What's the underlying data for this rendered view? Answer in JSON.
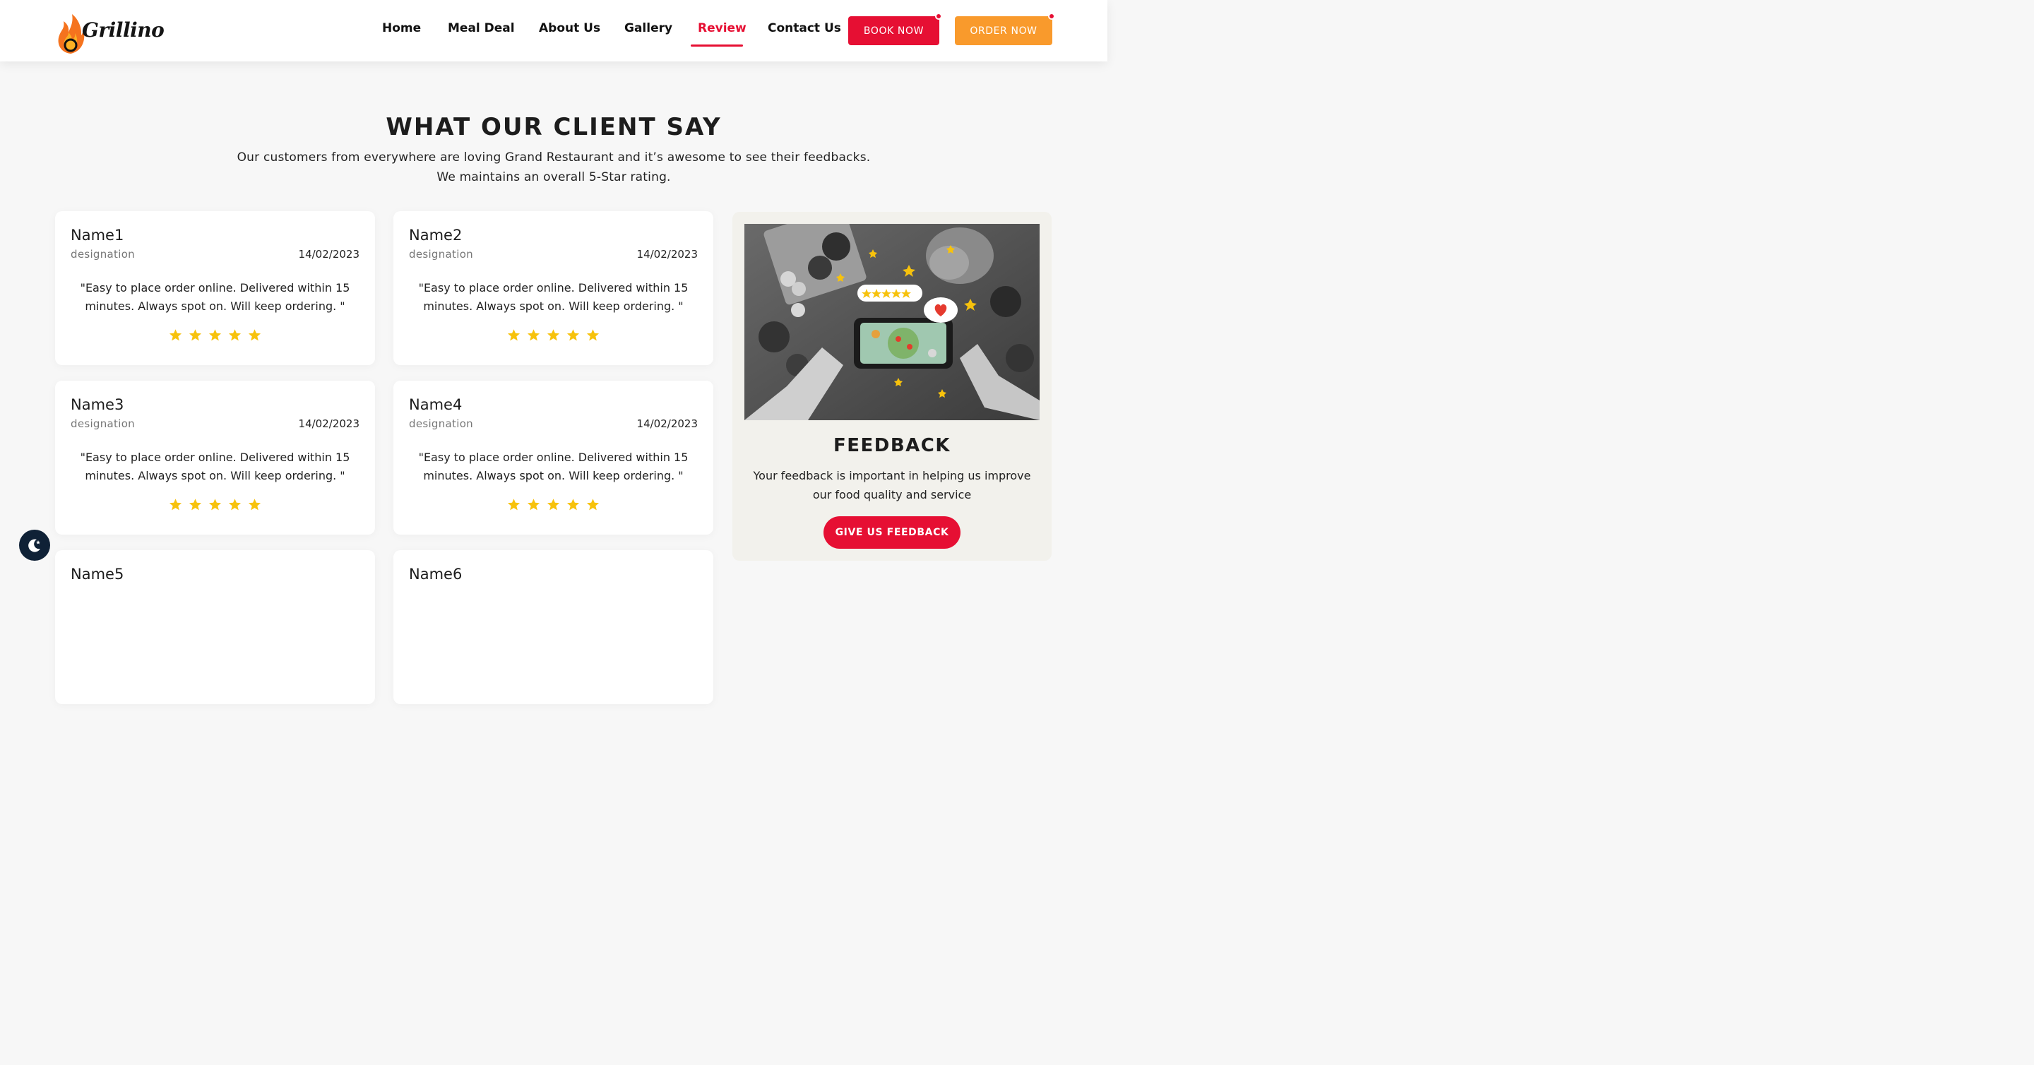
{
  "brand": {
    "name": "Grillino"
  },
  "nav": {
    "items": [
      "Home",
      "Meal Deal",
      "About Us",
      "Gallery",
      "Review",
      "Contact Us"
    ],
    "active": "Review",
    "book_label": "BOOK NOW",
    "order_label": "ORDER NOW"
  },
  "section": {
    "title": "WHAT OUR CLIENT SAY",
    "subtitle_line1": "Our customers from everywhere are loving Grand Restaurant and it’s awesome to see their feedbacks.",
    "subtitle_line2": "We maintains an overall 5-Star rating."
  },
  "reviews": [
    {
      "name": "Name1",
      "designation": "designation",
      "date": "14/02/2023",
      "text": "\"Easy to place order online. Delivered within 15 minutes. Always spot on. Will keep ordering. \"",
      "rating": 5
    },
    {
      "name": "Name2",
      "designation": "designation",
      "date": "14/02/2023",
      "text": "\"Easy to place order online. Delivered within 15 minutes. Always spot on. Will keep ordering. \"",
      "rating": 5
    },
    {
      "name": "Name3",
      "designation": "designation",
      "date": "14/02/2023",
      "text": "\"Easy to place order online. Delivered within 15 minutes. Always spot on. Will keep ordering. \"",
      "rating": 5
    },
    {
      "name": "Name4",
      "designation": "designation",
      "date": "14/02/2023",
      "text": "\"Easy to place order online. Delivered within 15 minutes. Always spot on. Will keep ordering. \"",
      "rating": 5
    },
    {
      "name": "Name5"
    },
    {
      "name": "Name6"
    }
  ],
  "feedback": {
    "title": "FEEDBACK",
    "text": "Your feedback is important in helping us improve our food quality and service",
    "button_label": "GIVE US FEEDBACK"
  },
  "colors": {
    "primary": "#e60f33",
    "accent": "#f99a2c",
    "star": "#f7c20c",
    "dark": "#0f2136"
  },
  "icons": {
    "theme_toggle": "moon-icon",
    "rating": "star-icon"
  }
}
